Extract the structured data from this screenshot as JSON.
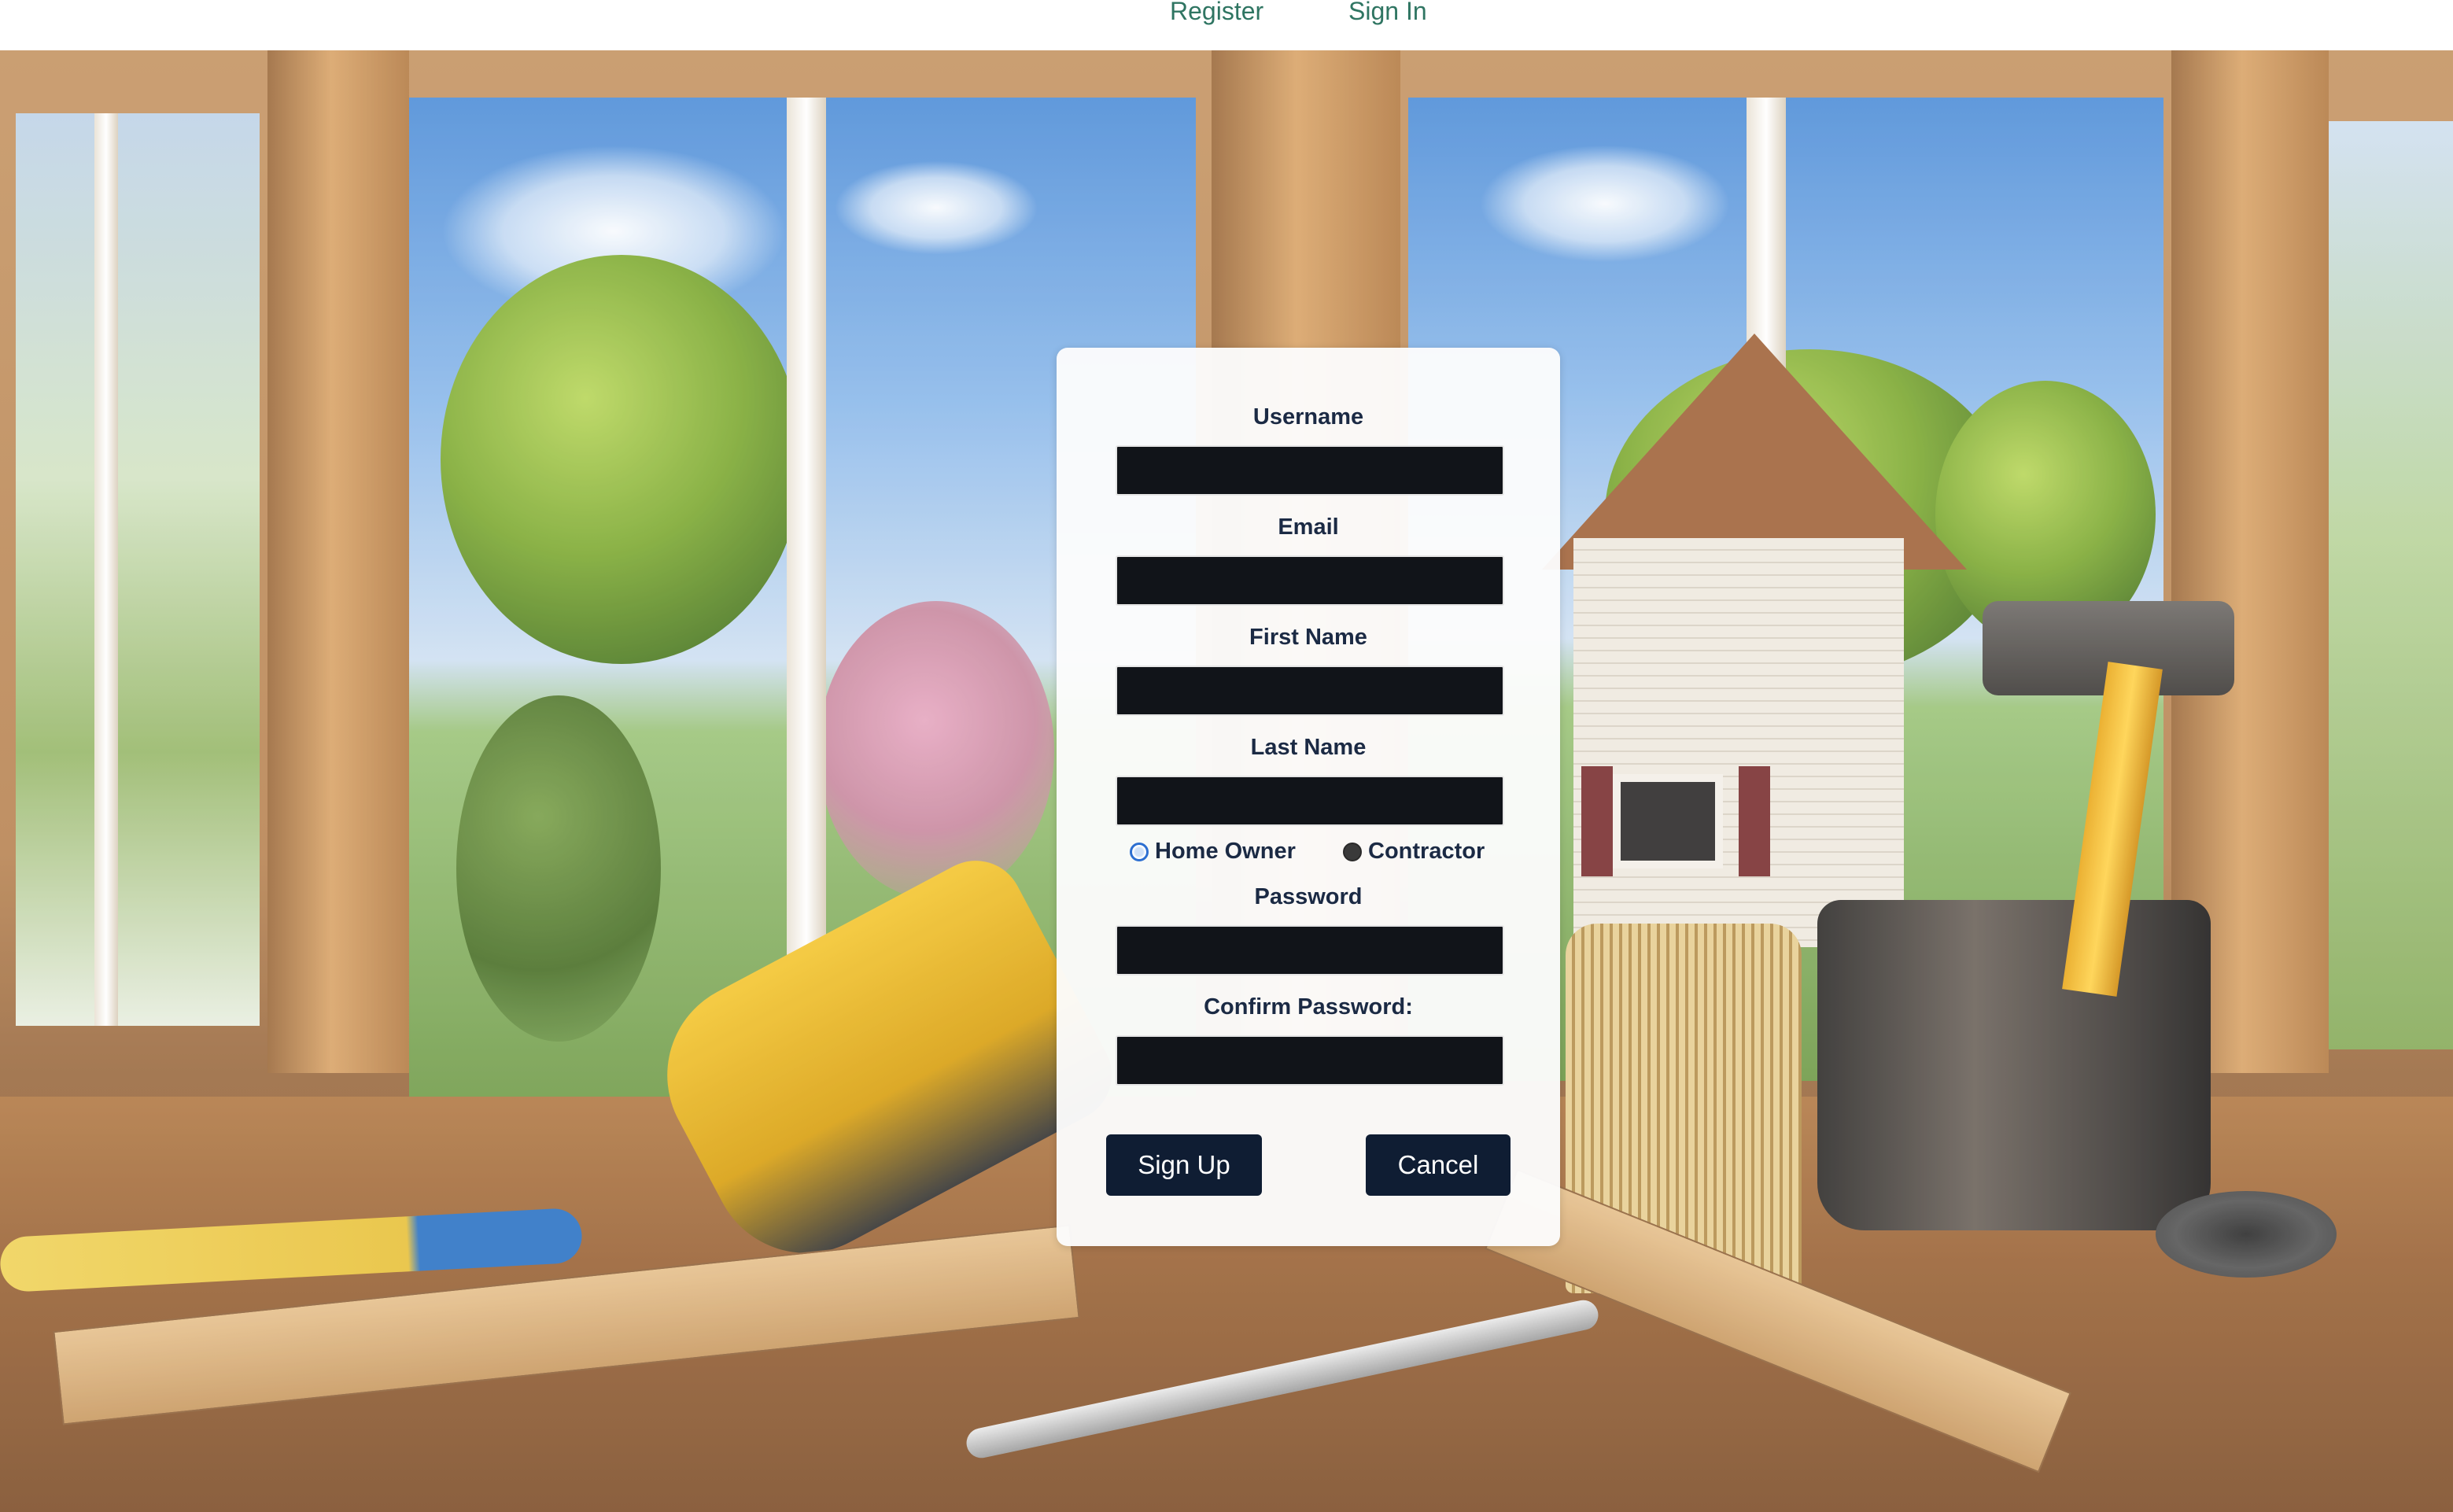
{
  "nav": {
    "register": "Register",
    "sign_in": "Sign In",
    "link_color": "#2f7562"
  },
  "form": {
    "fields": [
      {
        "label": "Username",
        "value": "",
        "placeholder": ""
      },
      {
        "label": "Email",
        "value": "",
        "placeholder": ""
      },
      {
        "label": "First Name",
        "value": "",
        "placeholder": ""
      },
      {
        "label": "Last Name",
        "value": "",
        "placeholder": ""
      }
    ],
    "account_type": {
      "options": [
        "Home Owner",
        "Contractor"
      ],
      "selected": "Home Owner"
    },
    "password": {
      "label": "Password",
      "value": "",
      "placeholder": ""
    },
    "confirm_password": {
      "label": "Confirm Password:",
      "value": "",
      "placeholder": ""
    },
    "buttons": {
      "sign_up": "Sign Up",
      "cancel": "Cancel"
    }
  },
  "colors": {
    "button_bg": "#0f1d33",
    "input_bg": "#111419",
    "label_text": "#1b2a44",
    "radio_accent": "#2d6fd1"
  }
}
